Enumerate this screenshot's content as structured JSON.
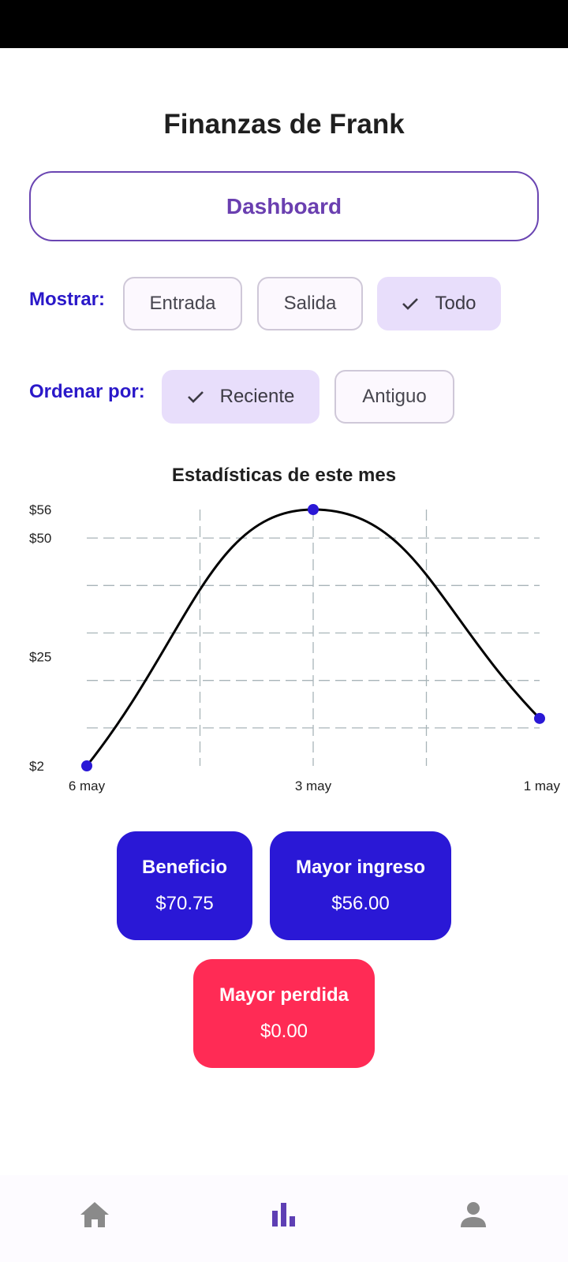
{
  "header": {
    "title": "Finanzas de Frank"
  },
  "dashboard_button": {
    "label": "Dashboard"
  },
  "filters": {
    "show_label": "Mostrar:",
    "show_options": [
      {
        "label": "Entrada",
        "selected": false
      },
      {
        "label": "Salida",
        "selected": false
      },
      {
        "label": "Todo",
        "selected": true
      }
    ],
    "sort_label": "Ordenar por:",
    "sort_options": [
      {
        "label": "Reciente",
        "selected": true
      },
      {
        "label": "Antiguo",
        "selected": false
      }
    ]
  },
  "chart_data": {
    "type": "line",
    "title": "Estadísticas de este mes",
    "x": [
      "6 may",
      "3 may",
      "1 may"
    ],
    "series": [
      {
        "values": [
          2,
          56,
          12
        ]
      }
    ],
    "y_tick_labels": [
      "$56",
      "$50",
      "$25",
      "$2"
    ],
    "y_ticks": [
      56,
      50,
      25,
      2
    ],
    "ylim": [
      2,
      56
    ],
    "grid": true,
    "line_color": "#000000",
    "point_color": "#2a18d6"
  },
  "stats": {
    "profit": {
      "title": "Beneficio",
      "value": "$70.75"
    },
    "top_income": {
      "title": "Mayor ingreso",
      "value": "$56.00"
    },
    "top_loss": {
      "title": "Mayor perdida",
      "value": "$0.00"
    }
  },
  "colors": {
    "accent": "#2a18d6",
    "loss": "#ff2b55",
    "dashboard_text": "#6a3fb0",
    "chip_selected": "#e8defb"
  },
  "nav": {
    "items": [
      {
        "icon": "home-icon",
        "active": false
      },
      {
        "icon": "bar-chart-icon",
        "active": true
      },
      {
        "icon": "person-icon",
        "active": false
      }
    ]
  }
}
